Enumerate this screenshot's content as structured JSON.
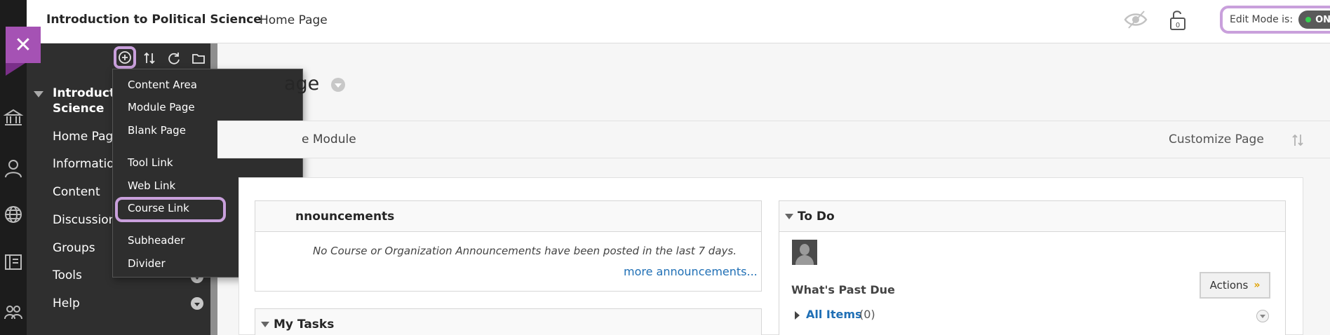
{
  "header": {
    "course_title": "Introduction to Political Science",
    "breadcrumb": "Home Page",
    "edit_mode_label": "Edit Mode is:",
    "edit_mode_value": "ON"
  },
  "institution_nav": {
    "icons": [
      "institution-icon",
      "person-icon",
      "globe-icon",
      "courses-icon",
      "groups-icon"
    ]
  },
  "course_menu": {
    "title": "Introduction to Political Science",
    "title_visible": "Introductio\nScience",
    "items": [
      {
        "label": "Home Page"
      },
      {
        "label": "Information"
      },
      {
        "label": "Content"
      },
      {
        "label": "Discussions"
      },
      {
        "label": "Groups"
      },
      {
        "label": "Tools"
      },
      {
        "label": "Help"
      }
    ]
  },
  "add_menu": {
    "items": [
      {
        "label": "Content Area"
      },
      {
        "label": "Module Page"
      },
      {
        "label": "Blank Page"
      },
      {
        "label": "Tool Link"
      },
      {
        "label": "Web Link"
      },
      {
        "label": "Course Link"
      },
      {
        "label": "Subheader"
      },
      {
        "label": "Divider"
      }
    ]
  },
  "main": {
    "page_heading": "age",
    "add_module": "e Module",
    "customize_page": "Customize Page"
  },
  "modules": {
    "announcements": {
      "title": "nnouncements",
      "empty_text": "No Course or Organization Announcements have been posted in the last 7 days.",
      "more_link": "more announcements..."
    },
    "tasks": {
      "title": "My Tasks"
    },
    "todo": {
      "title": "To Do",
      "past_due": "What's Past Due",
      "actions_label": "Actions",
      "all_items_label": "All Items",
      "all_items_count": "(0)"
    }
  },
  "colors": {
    "highlight": "#c9a0dc",
    "close_tab": "#a552b4",
    "menu_bg": "#2f2f2f",
    "link": "#1f6fb5",
    "toggle_on": "#37d050"
  }
}
